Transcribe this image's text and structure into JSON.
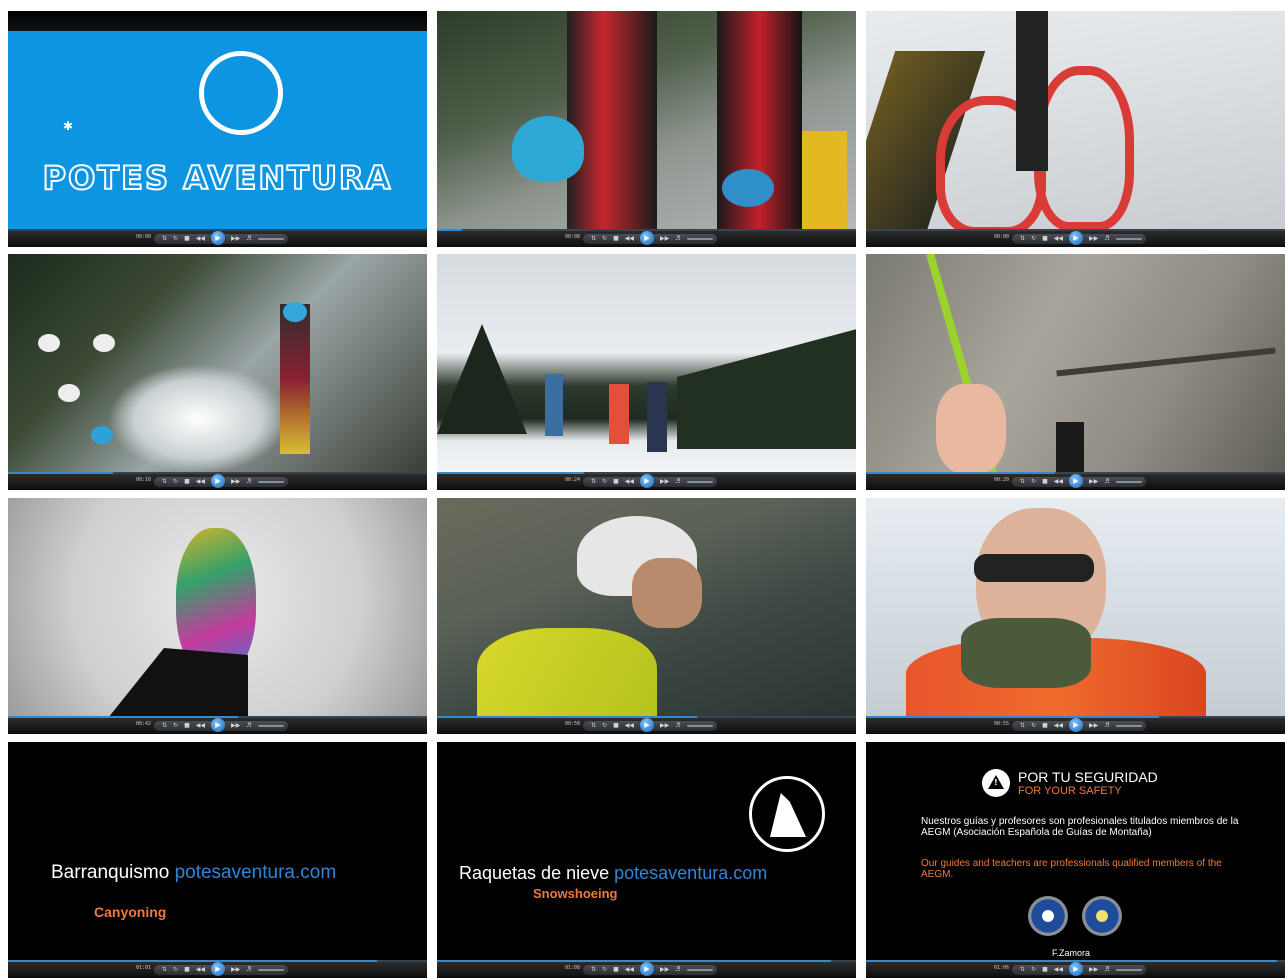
{
  "player": {
    "play_icon": "play-icon",
    "times": [
      "00:00",
      "00:08",
      "00:00",
      "00:16",
      "00:24",
      "00:29",
      "00:42",
      "00:50",
      "00:55",
      "01:01",
      "01:08",
      "01:06"
    ],
    "progress": [
      0.0,
      0.06,
      0.0,
      0.25,
      0.35,
      0.45,
      0.55,
      0.62,
      0.7,
      0.88,
      0.94,
      0.98
    ],
    "accent_color": "#2f8ad6"
  },
  "tiles": {
    "logo": {
      "brand": "POTES AVENTURA"
    },
    "barranquismo": {
      "title": "Barranquismo",
      "site": "potesaventura.com",
      "subtitle": "Canyoning"
    },
    "raquetas": {
      "title": "Raquetas de nieve",
      "site": "potesaventura.com",
      "subtitle": "Snowshoeing"
    },
    "safety": {
      "heading_es": "POR TU SEGURIDAD",
      "heading_en": "FOR YOUR SAFETY",
      "body_es": "Nuestros guías y profesores son profesionales titulados miembros de la AEGM (Asociación Española de Guías de Montaña)",
      "body_en": "Our guides and teachers are professionals qualified members of the AEGM.",
      "credit": "F.Zamora"
    }
  },
  "colors": {
    "brand_blue": "#0e95e1",
    "site_blue": "#2f86d6",
    "subtitle_orange": "#f07a3a"
  }
}
